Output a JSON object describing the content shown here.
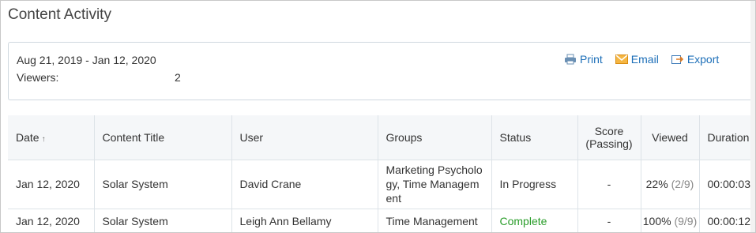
{
  "page": {
    "title": "Content Activity"
  },
  "summary": {
    "date_range": "Aug 21, 2019 - Jan 12, 2020",
    "viewers_label": "Viewers:",
    "viewers_value": "2"
  },
  "actions": {
    "print": "Print",
    "email": "Email",
    "export": "Export"
  },
  "table": {
    "headers": {
      "date": "Date",
      "content_title": "Content Title",
      "user": "User",
      "groups": "Groups",
      "status": "Status",
      "score_line1": "Score",
      "score_line2": "(Passing)",
      "viewed": "Viewed",
      "duration": "Duration"
    },
    "rows": [
      {
        "date": "Jan 12, 2020",
        "content_title": "Solar System",
        "user": "David Crane",
        "groups": "Marketing Psychology, Time Management",
        "status": "In Progress",
        "score": "-",
        "viewed_pct": "22%",
        "viewed_count": "(2/9)",
        "duration": "00:00:03"
      },
      {
        "date": "Jan 12, 2020",
        "content_title": "Solar System",
        "user": "Leigh Ann Bellamy",
        "groups": "Time Management",
        "status": "Complete",
        "score": "-",
        "viewed_pct": "100%",
        "viewed_count": "(9/9)",
        "duration": "00:00:12"
      }
    ]
  },
  "colors": {
    "link": "#1d6fb8",
    "complete": "#2a9d2a",
    "header_bg": "#f5f7f9"
  }
}
